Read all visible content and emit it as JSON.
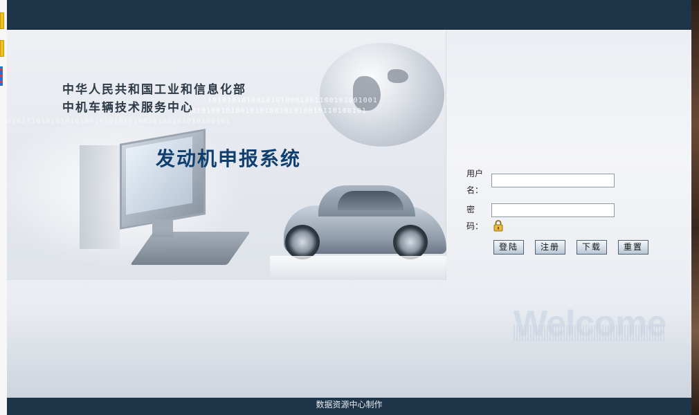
{
  "header": {
    "org_line1": "中华人民共和国工业和信息化部",
    "org_line2": "中机车辆技术服务中心",
    "system_title": "发动机申报系统"
  },
  "banner": {
    "binary_line1": "10101010100101010001001100101001001",
    "binary_line2": "1010100101001010100101010010110100101",
    "binary_line3": "0101110101010101001010101010010100101010100101"
  },
  "login": {
    "username_label_line1": "用户",
    "username_label_line2": "名：",
    "password_label_line1": "密",
    "password_label_line2": "码：",
    "username_value": "",
    "password_value": ""
  },
  "buttons": {
    "login": "登陆",
    "register": "注册",
    "download": "下载",
    "reset": "重置"
  },
  "decor": {
    "welcome_text": "Welcome"
  },
  "footer": {
    "text": "数据资源中心制作"
  },
  "colors": {
    "header_bar": "#1e3449",
    "title": "#0f3f6f",
    "button_border": "#4e6177"
  },
  "icons": {
    "lock": "lock-icon"
  }
}
